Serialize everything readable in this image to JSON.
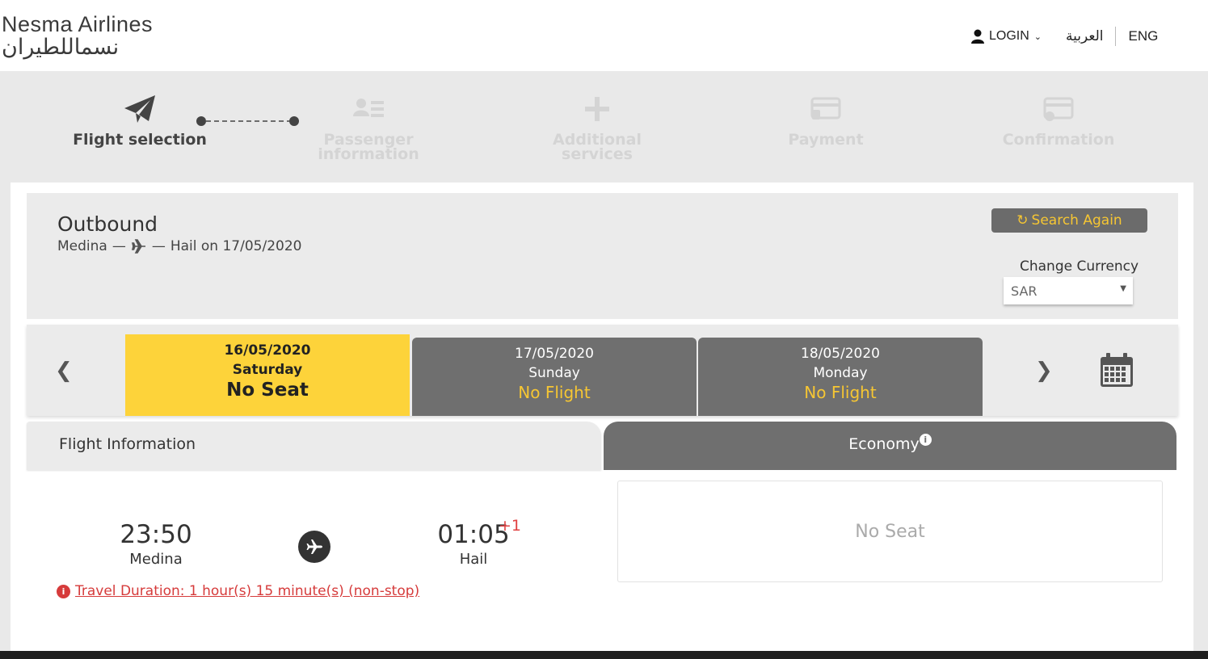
{
  "header": {
    "logo_en": "Nesma Airlines",
    "logo_ar": "نسماللطيران",
    "login_label": "LOGIN",
    "lang_ar": "العربية",
    "lang_en": "ENG"
  },
  "steps": [
    {
      "label": "Flight selection",
      "icon": "paper-plane-icon",
      "active": true
    },
    {
      "label": "Passenger information",
      "icon": "passenger-card-icon",
      "active": false
    },
    {
      "label": "Additional services",
      "icon": "plus-icon",
      "active": false
    },
    {
      "label": "Payment",
      "icon": "payment-card-icon",
      "active": false
    },
    {
      "label": "Confirmation",
      "icon": "confirmation-card-icon",
      "active": false
    }
  ],
  "outbound": {
    "title": "Outbound",
    "origin": "Medina",
    "destination": "Hail on 17/05/2020",
    "search_again": "Search Again",
    "currency_label": "Change Currency",
    "currency_value": "SAR"
  },
  "dates": [
    {
      "date": "16/05/2020",
      "day": "Saturday",
      "status": "No Seat",
      "selected": true
    },
    {
      "date": "17/05/2020",
      "day": "Sunday",
      "status": "No Flight",
      "selected": false
    },
    {
      "date": "18/05/2020",
      "day": "Monday",
      "status": "No Flight",
      "selected": false
    }
  ],
  "flight": {
    "info_header": "Flight Information",
    "class_header": "Economy",
    "dep_time": "23:50",
    "dep_city": "Medina",
    "arr_time": "01:05",
    "arr_day_offset": "+1",
    "arr_city": "Hail",
    "duration": "Travel Duration: 1 hour(s) 15 minute(s) (non-stop)",
    "seat_status": "No Seat"
  },
  "colors": {
    "accent_yellow": "#fdd33a",
    "accent_text_yellow": "#f6c633",
    "dark_gray": "#6f6f6f",
    "alert_red": "#d63b3b"
  }
}
